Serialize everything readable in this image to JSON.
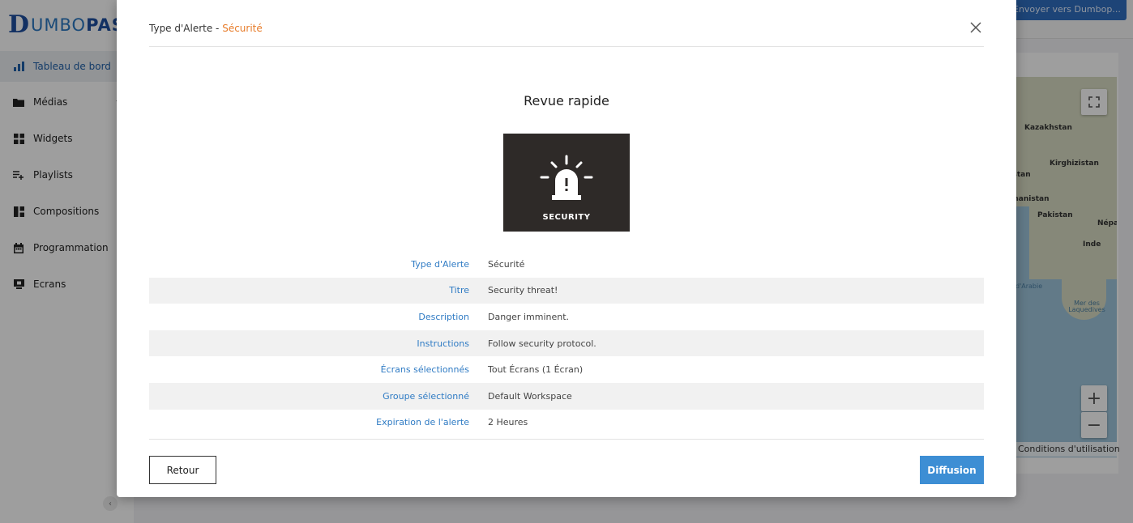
{
  "app": {
    "logo_initial": "D",
    "logo_text_pre": "UMBO",
    "logo_text_bold": "PASS",
    "send_button": "Envoyer vers Dumbop..."
  },
  "sidebar": {
    "items": [
      {
        "label": "Tableau de bord",
        "icon": "bar-chart-icon",
        "active": true
      },
      {
        "label": "Médias",
        "icon": "folder-icon",
        "has_chevron": true
      },
      {
        "label": "Widgets",
        "icon": "widgets-grid-icon"
      },
      {
        "label": "Playlists",
        "icon": "playlist-icon"
      },
      {
        "label": "Compositions",
        "icon": "compositions-layout-icon"
      },
      {
        "label": "Programmation",
        "icon": "calendar-icon"
      },
      {
        "label": "Ecrans",
        "icon": "monitor-icon"
      }
    ],
    "collapse_glyph": "‹"
  },
  "map": {
    "labels": [
      "Kazakhstan",
      "Kirghizistan",
      "nistan",
      "fghanistan",
      "Pakistan",
      "Népa",
      "Inde"
    ],
    "water_labels": [
      "ler d'Arabie",
      "Mer des Laquedives"
    ],
    "terms": "Conditions d'utilisation",
    "zoom_in": "+",
    "zoom_out": "−"
  },
  "modal": {
    "title_prefix": "Type d'Alerte - ",
    "title_value": "Sécurité",
    "review_title": "Revue rapide",
    "image_caption": "SECURITY",
    "details": [
      {
        "key": "Type d'Alerte",
        "value": "Sécurité"
      },
      {
        "key": "Titre",
        "value": "Security threat!"
      },
      {
        "key": "Description",
        "value": "Danger imminent."
      },
      {
        "key": "Instructions",
        "value": "Follow security protocol."
      },
      {
        "key": "Écrans sélectionnés",
        "value": "Tout Écrans (1 Écran)"
      },
      {
        "key": "Groupe sélectionné",
        "value": "Default Workspace"
      },
      {
        "key": "Expiration de l'alerte",
        "value": "2 Heures"
      }
    ],
    "back_label": "Retour",
    "broadcast_label": "Diffusion"
  },
  "colors": {
    "accent_orange": "#e77b28",
    "label_blue": "#2f7bc4",
    "primary_button": "#3d8ed4",
    "image_bg": "#2e2a28"
  }
}
